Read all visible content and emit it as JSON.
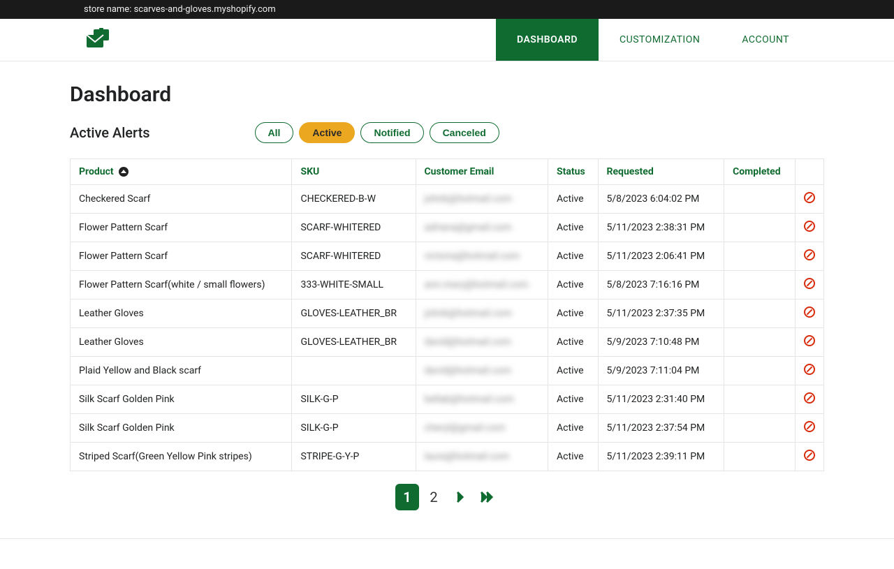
{
  "topbar": {
    "label": "store name: scarves-and-gloves.myshopify.com"
  },
  "nav": {
    "items": [
      {
        "label": "DASHBOARD",
        "active": true
      },
      {
        "label": "CUSTOMIZATION",
        "active": false
      },
      {
        "label": "ACCOUNT",
        "active": false
      }
    ]
  },
  "page_title": "Dashboard",
  "section_title": "Active Alerts",
  "filters": [
    {
      "label": "All",
      "active": false
    },
    {
      "label": "Active",
      "active": true
    },
    {
      "label": "Notified",
      "active": false
    },
    {
      "label": "Canceled",
      "active": false
    }
  ],
  "table": {
    "headers": {
      "product": "Product",
      "sku": "SKU",
      "email": "Customer Email",
      "status": "Status",
      "requested": "Requested",
      "completed": "Completed"
    },
    "rows": [
      {
        "product": "Checkered Scarf",
        "sku": "CHECKERED-B-W",
        "email": "johnb@hotmail.com",
        "status": "Active",
        "requested": "5/8/2023 6:04:02 PM",
        "completed": ""
      },
      {
        "product": "Flower Pattern Scarf",
        "sku": "SCARF-WHITERED",
        "email": "adriana@gmail.com",
        "status": "Active",
        "requested": "5/11/2023 2:38:31 PM",
        "completed": ""
      },
      {
        "product": "Flower Pattern Scarf",
        "sku": "SCARF-WHITERED",
        "email": "victoria@hotmail.com",
        "status": "Active",
        "requested": "5/11/2023 2:06:41 PM",
        "completed": ""
      },
      {
        "product": "Flower Pattern Scarf(white / small flowers)",
        "sku": "333-WHITE-SMALL",
        "email": "ann.mary@hotmail.com",
        "status": "Active",
        "requested": "5/8/2023 7:16:16 PM",
        "completed": ""
      },
      {
        "product": "Leather Gloves",
        "sku": "GLOVES-LEATHER_BR",
        "email": "johnb@hotmail.com",
        "status": "Active",
        "requested": "5/11/2023 2:37:35 PM",
        "completed": ""
      },
      {
        "product": "Leather Gloves",
        "sku": "GLOVES-LEATHER_BR",
        "email": "david@hotmail.com",
        "status": "Active",
        "requested": "5/9/2023 7:10:48 PM",
        "completed": ""
      },
      {
        "product": "Plaid Yellow and Black scarf",
        "sku": "",
        "email": "david@hotmail.com",
        "status": "Active",
        "requested": "5/9/2023 7:11:04 PM",
        "completed": ""
      },
      {
        "product": "Silk Scarf Golden Pink",
        "sku": "SILK-G-P",
        "email": "bellab@hotmail.com",
        "status": "Active",
        "requested": "5/11/2023 2:31:40 PM",
        "completed": ""
      },
      {
        "product": "Silk Scarf Golden Pink",
        "sku": "SILK-G-P",
        "email": "cheryl@gmail.com",
        "status": "Active",
        "requested": "5/11/2023 2:37:54 PM",
        "completed": ""
      },
      {
        "product": "Striped Scarf(Green Yellow Pink stripes)",
        "sku": "STRIPE-G-Y-P",
        "email": "laura@hotmail.com",
        "status": "Active",
        "requested": "5/11/2023 2:39:11 PM",
        "completed": ""
      }
    ]
  },
  "pagination": {
    "current": "1",
    "next": "2"
  }
}
